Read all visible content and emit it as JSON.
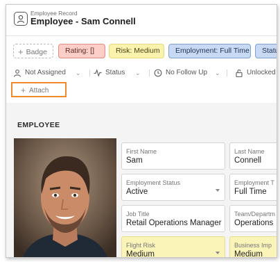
{
  "header": {
    "subtitle": "Employee Record",
    "title": "Employee - Sam Connell"
  },
  "badges": {
    "add_label": "Badge",
    "rating": "Rating: []",
    "risk": "Risk: Medium",
    "employment": "Employment: Full Time",
    "status": "Status"
  },
  "meta": {
    "assignee": "Not Assigned",
    "status": "Status",
    "follow_up": "No Follow Up",
    "lock": "Unlocked"
  },
  "attach": {
    "label": "Attach"
  },
  "section": {
    "title": "EMPLOYEE"
  },
  "fields": {
    "first_name": {
      "label": "First Name",
      "value": "Sam"
    },
    "last_name": {
      "label": "Last Name",
      "value": "Connell"
    },
    "employment_status": {
      "label": "Employment Status",
      "value": "Active"
    },
    "employment_type": {
      "label": "Employment T",
      "value": "Full Time"
    },
    "job_title": {
      "label": "Job Title",
      "value": "Retail Operations Manager"
    },
    "team": {
      "label": "Team/Departm",
      "value": "Operations"
    },
    "flight_risk": {
      "label": "Flight Risk",
      "value": "Medium"
    },
    "business_impact": {
      "label": "Business Imp",
      "value": "Medium"
    }
  },
  "colors": {
    "accent_orange": "#ef8a2c",
    "rating_bg": "#fbcfc7",
    "risk_bg": "#fbf3ad",
    "employment_bg": "#c7d9f3",
    "highlight_field": "#fbf4b9"
  },
  "icons": {
    "record": "person-card-icon",
    "assignee": "person-icon",
    "status": "activity-icon",
    "follow_up": "clock-icon",
    "lock": "padlock-icon"
  }
}
